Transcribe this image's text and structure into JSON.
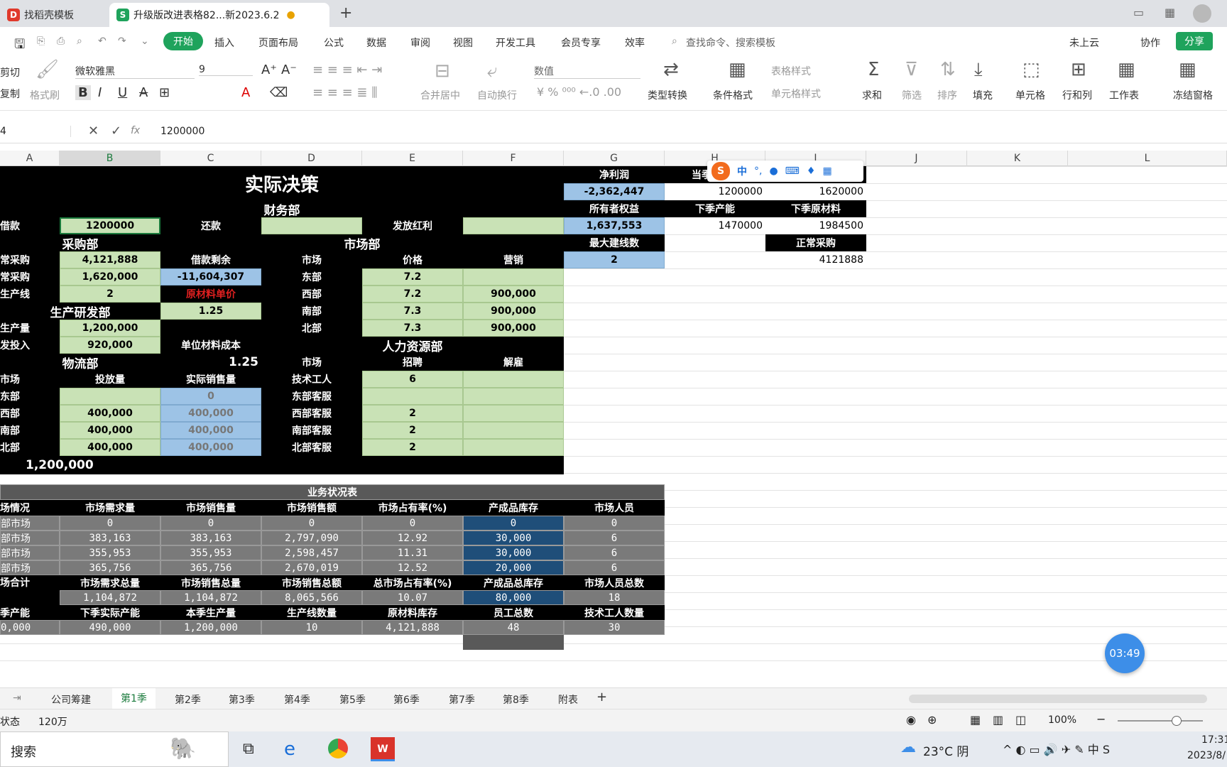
{
  "tabs": {
    "t1": "找稻壳模板",
    "t2": "升级版改进表格82...新2023.6.2"
  },
  "menu": {
    "start": "开始",
    "insert": "插入",
    "layout": "页面布局",
    "formula": "公式",
    "data": "数据",
    "review": "审阅",
    "view": "视图",
    "dev": "开发工具",
    "member": "会员专享",
    "efficiency": "效率",
    "search": "查找命令、搜索模板",
    "cloud": "未上云",
    "collab": "协作",
    "share": "分享"
  },
  "ribbon": {
    "cut": "剪切",
    "copy": "复制",
    "painter": "格式刷",
    "font": "微软雅黑",
    "size": "9",
    "merge": "合并居中",
    "wrap": "自动换行",
    "numfmt": "数值",
    "convert": "类型转换",
    "cond": "条件格式",
    "tablestyle": "表格样式",
    "cellstyle": "单元格样式",
    "sum": "求和",
    "filter": "筛选",
    "sort": "排序",
    "fill": "填充",
    "cell": "单元格",
    "rowcol": "行和列",
    "sheet": "工作表",
    "freeze": "冻结窗格"
  },
  "formula": {
    "ref": "4",
    "fx": "fx",
    "value": "1200000"
  },
  "cols": [
    "A",
    "B",
    "C",
    "D",
    "E",
    "F",
    "G",
    "H",
    "I",
    "J",
    "K",
    "L"
  ],
  "cells": {
    "title": "实际决策",
    "finance": "财务部",
    "borrow": "借款",
    "borrow_v": "1200000",
    "repay": "还款",
    "dividend": "发放红利",
    "purchase": "采购部",
    "market": "市场部",
    "normal_buy": "常采购",
    "nb_v": "4,121,888",
    "loan_rem": "借款剩余",
    "mkt": "市场",
    "price": "价格",
    "sales": "营销",
    "urgent_buy": "常采购",
    "ub_v": "1,620,000",
    "loan_rem_v": "-11,604,307",
    "east": "东部",
    "east_p": "7.2",
    "line": "生产线",
    "line_v": "2",
    "raw_price": "原材料单价",
    "west": "西部",
    "west_p": "7.2",
    "west_s": "900,000",
    "prod_rd": "生产研发部",
    "raw_price_v": "1.25",
    "south": "南部",
    "south_p": "7.3",
    "south_s": "900,000",
    "plan": "生产量",
    "plan_v": "1,200,000",
    "north": "北部",
    "north_p": "7.3",
    "north_s": "900,000",
    "rd": "发投入",
    "rd_v": "920,000",
    "unit_cost": "单位材料成本",
    "hr": "人力资源部",
    "logistics": "物流部",
    "unit_cost_v": "1.25",
    "hire": "招聘",
    "fire": "解雇",
    "l_market": "市场",
    "invest": "投放量",
    "actual_sales": "实际销售量",
    "tech": "技术工人",
    "tech_v": "6",
    "l_east": "东部",
    "l_east_a": "0",
    "cs_east": "东部客服",
    "l_west": "西部",
    "l_west_i": "400,000",
    "l_west_a": "400,000",
    "cs_west": "西部客服",
    "cs_west_v": "2",
    "l_south": "南部",
    "l_south_i": "400,000",
    "l_south_a": "400,000",
    "cs_south": "南部客服",
    "cs_south_v": "2",
    "l_north": "北部",
    "l_north_i": "400,000",
    "l_north_a": "400,000",
    "cs_north": "北部客服",
    "cs_north_v": "2",
    "total": "1,200,000",
    "g_net": "净利润",
    "g_net_v": "-2,362,447",
    "g_equity": "所有者权益",
    "g_equity_v": "1,637,553",
    "g_maxline": "最大建线数",
    "g_maxline_v": "2",
    "h_hdr": "当季",
    "h1": "1200000",
    "i1": "1620000",
    "h_next": "下季产能",
    "i_next": "下季原材料",
    "h2": "1470000",
    "i2": "1984500",
    "i_normal": "正常采购",
    "i3": "4121888"
  },
  "biz": {
    "title": "业务状况表",
    "hdr": [
      "场情况",
      "市场需求量",
      "市场销售量",
      "市场销售额",
      "市场占有率(%)",
      "产成品库存",
      "市场人员"
    ],
    "rows": [
      [
        "部市场",
        "0",
        "0",
        "0",
        "0",
        "0",
        "0"
      ],
      [
        "部市场",
        "383,163",
        "383,163",
        "2,797,090",
        "12.92",
        "30,000",
        "6"
      ],
      [
        "部市场",
        "355,953",
        "355,953",
        "2,598,457",
        "11.31",
        "30,000",
        "6"
      ],
      [
        "部市场",
        "365,756",
        "365,756",
        "2,670,019",
        "12.52",
        "20,000",
        "6"
      ]
    ],
    "sum_label": "场合计",
    "sum_hdr": [
      "市场需求总量",
      "市场销售总量",
      "市场销售总额",
      "总市场占有率(%)",
      "产成品总库存",
      "市场人员总数"
    ],
    "sum_vals": [
      "1,104,872",
      "1,104,872",
      "8,065,566",
      "10.07",
      "80,000",
      "18"
    ],
    "cap_hdr": [
      "季产能",
      "下季实际产能",
      "本季生产量",
      "生产线数量",
      "原材料库存",
      "员工总数",
      "技术工人数量"
    ],
    "cap_vals": [
      "0,000",
      "490,000",
      "1,200,000",
      "10",
      "4,121,888",
      "48",
      "30"
    ]
  },
  "sheets": [
    "公司筹建",
    "第1季",
    "第2季",
    "第3季",
    "第4季",
    "第5季",
    "第6季",
    "第7季",
    "第8季",
    "附表"
  ],
  "status": {
    "label": "状态",
    "value": "120万",
    "zoom": "100%"
  },
  "timer": "03:49",
  "taskbar": {
    "search": "搜索",
    "weather": "23°C 阴",
    "time": "17:31",
    "date": "2023/8/"
  },
  "ime": {
    "zh": "中"
  }
}
